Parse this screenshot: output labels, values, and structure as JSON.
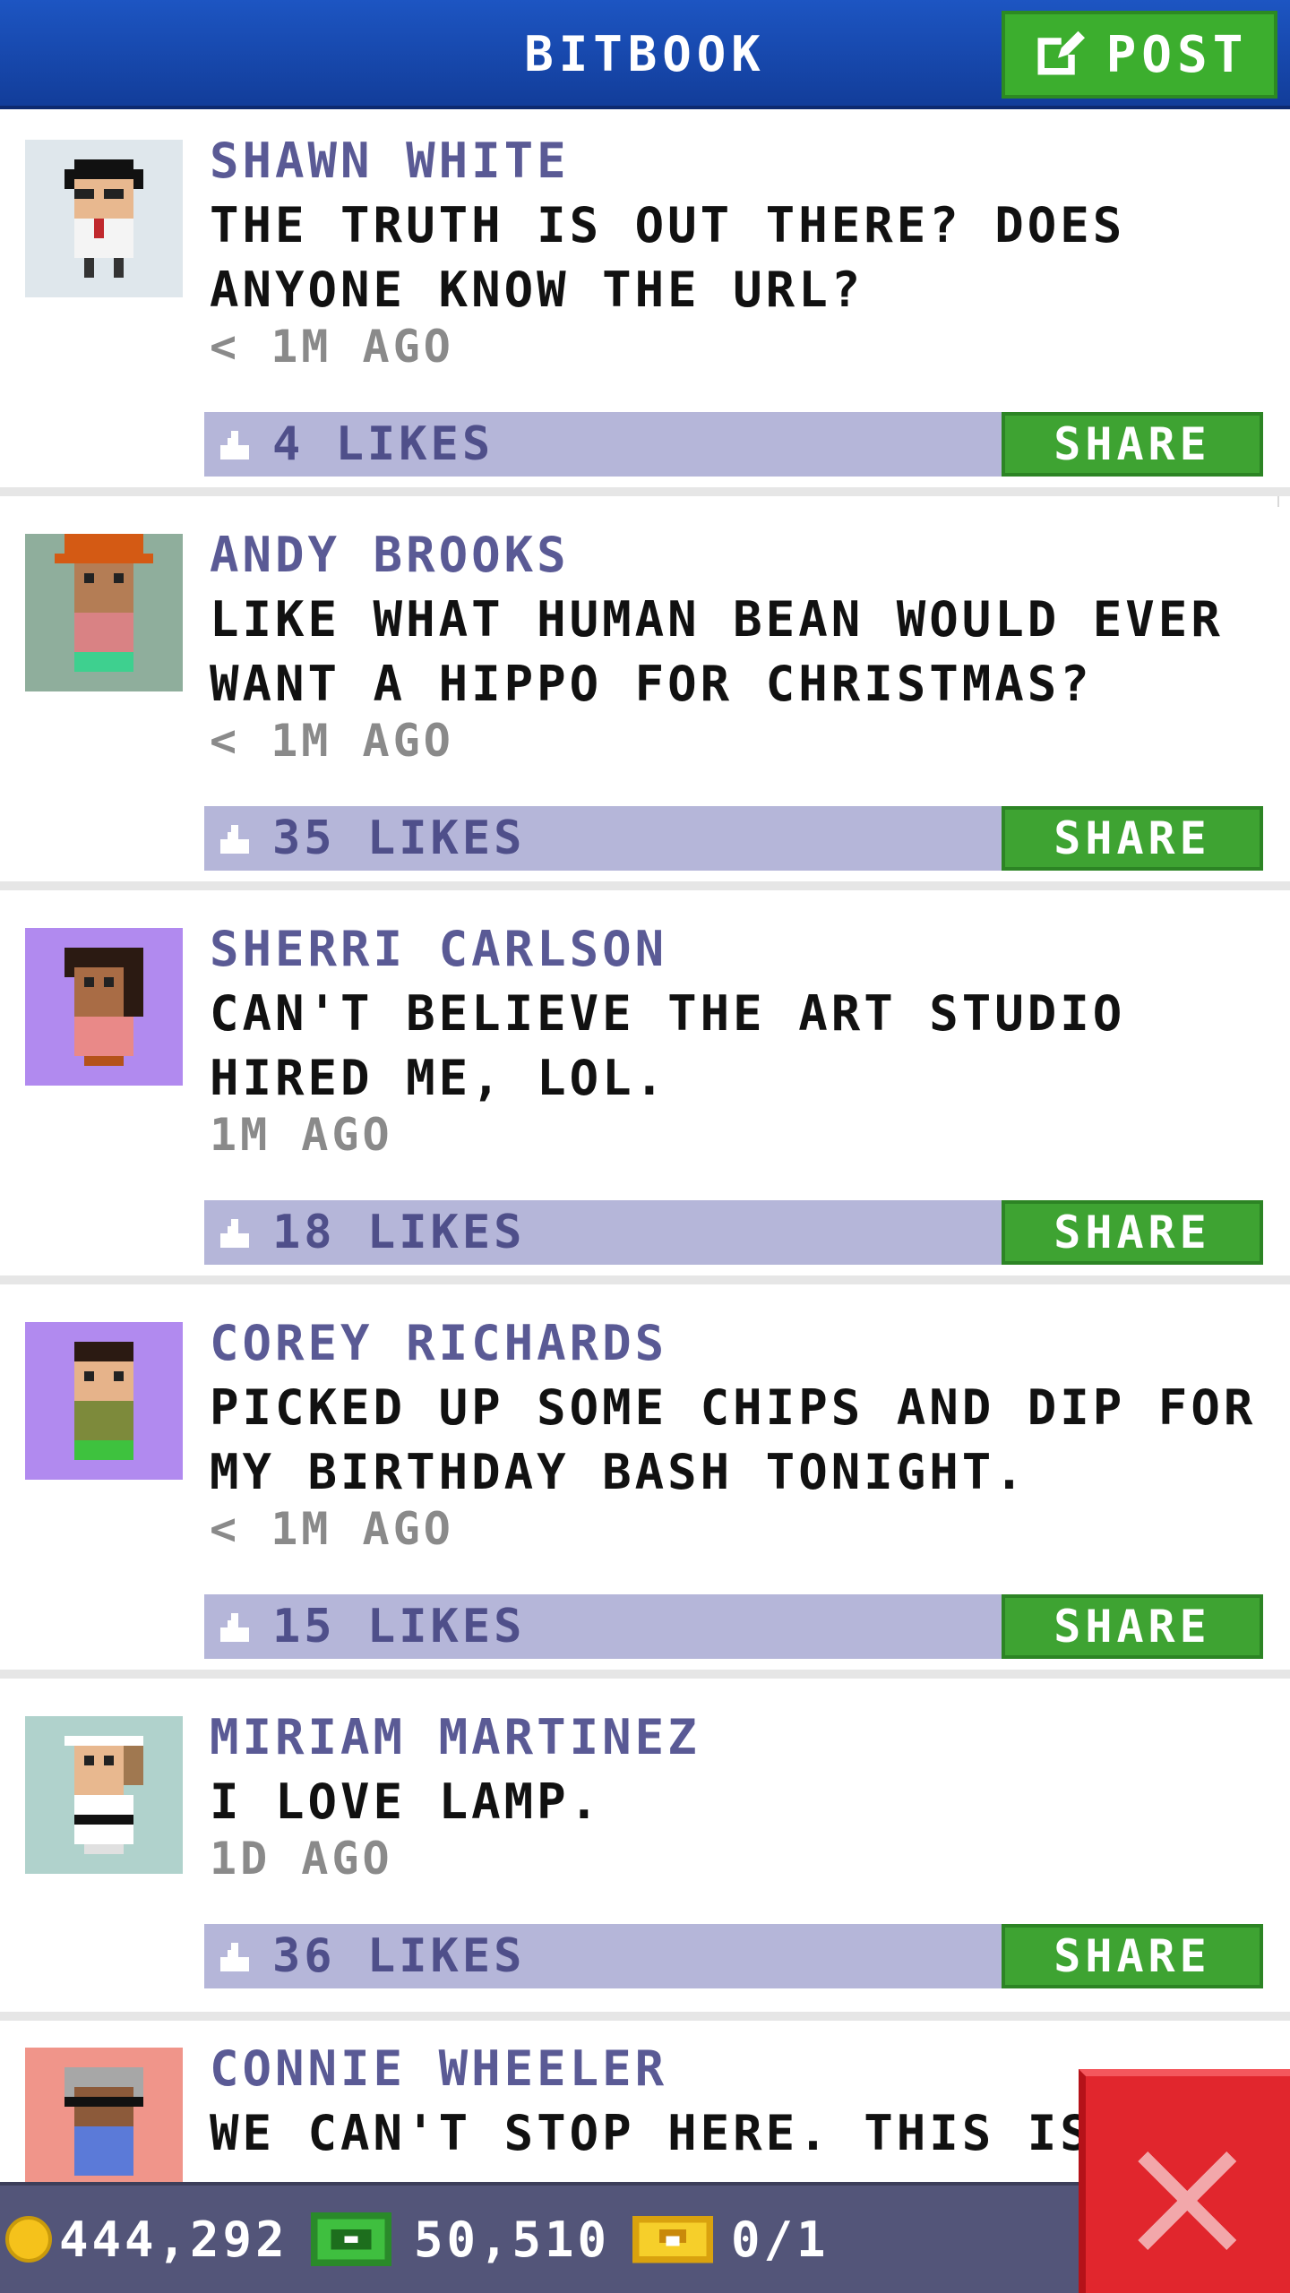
{
  "header": {
    "title": "BITBOOK",
    "post_label": "POST"
  },
  "posts": [
    {
      "author": "SHAWN WHITE",
      "message": "THE TRUTH IS OUT THERE? DOES ANYONE KNOW THE URL?",
      "time": "< 1M AGO",
      "likes": "4 LIKES",
      "share": "SHARE",
      "avatar_bg": "#dfe7ec"
    },
    {
      "author": "ANDY BROOKS",
      "message": "LIKE WHAT HUMAN BEAN WOULD EVER WANT A HIPPO FOR CHRISTMAS?",
      "time": "< 1M AGO",
      "likes": "35 LIKES",
      "share": "SHARE",
      "avatar_bg": "#8fae9c"
    },
    {
      "author": "SHERRI CARLSON",
      "message": "CAN'T BELIEVE THE ART STUDIO HIRED ME, LOL.",
      "time": "1M AGO",
      "likes": "18 LIKES",
      "share": "SHARE",
      "avatar_bg": "#b18aef"
    },
    {
      "author": "COREY RICHARDS",
      "message": "PICKED UP SOME CHIPS AND DIP FOR MY BIRTHDAY BASH TONIGHT.",
      "time": "< 1M AGO",
      "likes": "15 LIKES",
      "share": "SHARE",
      "avatar_bg": "#b18aef"
    },
    {
      "author": "MIRIAM MARTINEZ",
      "message": "I LOVE LAMP.",
      "time": "1D AGO",
      "likes": "36 LIKES",
      "share": "SHARE",
      "avatar_bg": "#b0d2cc"
    },
    {
      "author": "CONNIE WHEELER",
      "message": "WE CAN'T STOP HERE. THIS IS BA",
      "time": "",
      "likes": "",
      "share": "",
      "avatar_bg": "#f0958a"
    }
  ],
  "bottom_bar": {
    "coins": "444,292",
    "bux": "50,510",
    "tickets": "0/1"
  },
  "colors": {
    "header": "#1d55c2",
    "share": "#3ea332",
    "like_bar": "#b5b6d9",
    "author": "#5a5a95",
    "close": "#e1262d"
  },
  "icons": [
    "post-edit-icon",
    "like-icon",
    "coin-icon",
    "bux-icon",
    "ticket-icon",
    "close-icon"
  ]
}
